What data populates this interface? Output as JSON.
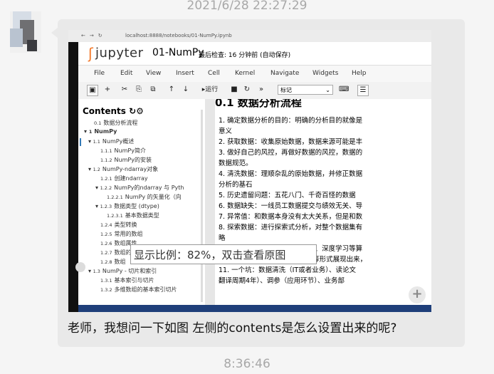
{
  "timestamp_top": "2021/6/28 22:27:29",
  "timestamp_bottom": "8:36:46",
  "message": "老师，我想问一下如图 左侧的contents是怎么设置出来的呢?",
  "image_tooltip": "显示比例：82%，双击查看原图",
  "screenshot": {
    "url": "localhost:8888/notebooks/01-NumPy.ipynb",
    "brand": "jupyter",
    "notebook_name": "01-NumPy",
    "checkpoint": "最后检查: 16 分钟前  (自动保存)",
    "menu": [
      "File",
      "Edit",
      "View",
      "Insert",
      "Cell",
      "Kernel",
      "Navigate",
      "Widgets",
      "Help"
    ],
    "run_label": "运行",
    "cell_type": "标记",
    "toc_title": "Contents",
    "toc_items": [
      {
        "num": "0.1",
        "label": "数据分析流程"
      },
      {
        "num": "1",
        "label": "NumPy"
      },
      {
        "num": "1.1",
        "label": "NumPy概述"
      },
      {
        "num": "1.1.1",
        "label": "NumPy简介"
      },
      {
        "num": "1.1.2",
        "label": "NumPy的安装"
      },
      {
        "num": "1.2",
        "label": "NumPy-ndarray对象"
      },
      {
        "num": "1.2.1",
        "label": "创建ndarray"
      },
      {
        "num": "1.2.2",
        "label": "NumPy的ndarray 与 Pyth"
      },
      {
        "num": "1.2.2.1",
        "label": "NumPy 的矢量化（向"
      },
      {
        "num": "1.2.3",
        "label": "数据类型 (dtype)"
      },
      {
        "num": "1.2.3.1",
        "label": "基本数据类型"
      },
      {
        "num": "1.2.4",
        "label": "类型转换"
      },
      {
        "num": "1.2.5",
        "label": "常用的数组"
      },
      {
        "num": "1.2.6",
        "label": "数组属性"
      },
      {
        "num": "1.2.7",
        "label": "数组的"
      },
      {
        "num": "1.2.8",
        "label": "数组"
      },
      {
        "num": "1.3",
        "label": "NumPy - 切片和索引"
      },
      {
        "num": "1.3.1",
        "label": "基本索引与切片"
      },
      {
        "num": "1.3.2",
        "label": "多维数组的基本索引切片"
      }
    ],
    "heading": "0.1  数据分析流程",
    "content_lines": [
      "1. 确定数据分析的目的：明确的分析目的就像是",
      "    意义",
      "2. 获取数据：收集原始数据，数据来源可能是丰",
      "3. 做好自己的风控，再做好数据的风控，数据的",
      "    数据规范。",
      "4. 清洗数据：理顺杂乱的原始数据，并修正数据",
      "    分析的基石",
      "5. 历史遗留问题：五花八门、千奇百怪的数据",
      "6. 数据缺失：一线员工数据提交与绩效无关、导",
      "7. 异常值：和数据本身没有太大关系，但是和数",
      "8. 探索数据：进行探索式分析，对整个数据集有",
      "    略",
      "9. 建模分析：常常用到机器学习、深度学习等算",
      "10. 数据展示：使用报告、图表等形式展现出来，",
      "11. 一个坑：数据清洗（IT或者业务）、读论文",
      "    翻译周期4年）、调参（应用环节）、业务部"
    ]
  }
}
